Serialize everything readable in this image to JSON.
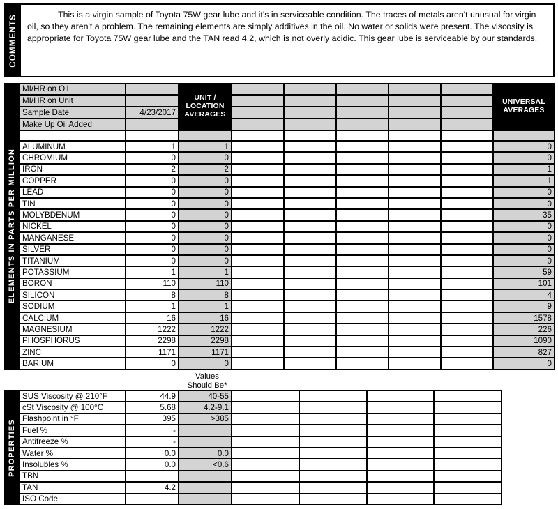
{
  "comments": {
    "label": "COMMENTS",
    "text": "This is a virgin sample of Toyota 75W gear lube and it's in serviceable condition. The traces of metals aren't unusual for virgin oil, so they aren't a problem. The remaining elements are simply additives in the oil. No water or solids were present. The viscosity is appropriate for Toyota 75W gear lube and the TAN read 4.2, which is not overly acidic. This gear lube is serviceable by our standards."
  },
  "elements_section": {
    "label": "ELEMENTS IN PARTS PER MILLION",
    "column_headers": {
      "unit_location_averages": "UNIT / LOCATION AVERAGES",
      "universal_averages": "UNIVERSAL AVERAGES"
    },
    "info_rows": [
      {
        "label": "MI/HR on Oil",
        "value": ""
      },
      {
        "label": "MI/HR on Unit",
        "value": ""
      },
      {
        "label": "Sample Date",
        "value": "4/23/2017"
      },
      {
        "label": "Make Up Oil Added",
        "value": ""
      }
    ],
    "rows": [
      {
        "name": "ALUMINUM",
        "sample": "1",
        "unit_avg": "1",
        "universal_avg": "0"
      },
      {
        "name": "CHROMIUM",
        "sample": "0",
        "unit_avg": "0",
        "universal_avg": "0"
      },
      {
        "name": "IRON",
        "sample": "2",
        "unit_avg": "2",
        "universal_avg": "1"
      },
      {
        "name": "COPPER",
        "sample": "0",
        "unit_avg": "0",
        "universal_avg": "1"
      },
      {
        "name": "LEAD",
        "sample": "0",
        "unit_avg": "0",
        "universal_avg": "0"
      },
      {
        "name": "TIN",
        "sample": "0",
        "unit_avg": "0",
        "universal_avg": "0"
      },
      {
        "name": "MOLYBDENUM",
        "sample": "0",
        "unit_avg": "0",
        "universal_avg": "35"
      },
      {
        "name": "NICKEL",
        "sample": "0",
        "unit_avg": "0",
        "universal_avg": "0"
      },
      {
        "name": "MANGANESE",
        "sample": "0",
        "unit_avg": "0",
        "universal_avg": "0"
      },
      {
        "name": "SILVER",
        "sample": "0",
        "unit_avg": "0",
        "universal_avg": "0"
      },
      {
        "name": "TITANIUM",
        "sample": "0",
        "unit_avg": "0",
        "universal_avg": "0"
      },
      {
        "name": "POTASSIUM",
        "sample": "1",
        "unit_avg": "1",
        "universal_avg": "59"
      },
      {
        "name": "BORON",
        "sample": "110",
        "unit_avg": "110",
        "universal_avg": "101"
      },
      {
        "name": "SILICON",
        "sample": "8",
        "unit_avg": "8",
        "universal_avg": "4"
      },
      {
        "name": "SODIUM",
        "sample": "1",
        "unit_avg": "1",
        "universal_avg": "9"
      },
      {
        "name": "CALCIUM",
        "sample": "16",
        "unit_avg": "16",
        "universal_avg": "1578"
      },
      {
        "name": "MAGNESIUM",
        "sample": "1222",
        "unit_avg": "1222",
        "universal_avg": "226"
      },
      {
        "name": "PHOSPHORUS",
        "sample": "2298",
        "unit_avg": "2298",
        "universal_avg": "1090"
      },
      {
        "name": "ZINC",
        "sample": "1171",
        "unit_avg": "1171",
        "universal_avg": "827"
      },
      {
        "name": "BARIUM",
        "sample": "0",
        "unit_avg": "0",
        "universal_avg": "0"
      }
    ]
  },
  "values_should_be_caption": {
    "line1": "Values",
    "line2": "Should Be*"
  },
  "properties_section": {
    "label": "PROPERTIES",
    "rows": [
      {
        "name": "SUS Viscosity @ 210°F",
        "sample": "44.9",
        "should_be": "40-55"
      },
      {
        "name": "cSt Viscosity @ 100°C",
        "sample": "5.68",
        "should_be": "4.2-9.1"
      },
      {
        "name": "Flashpoint in °F",
        "sample": "395",
        "should_be": ">385"
      },
      {
        "name": "Fuel %",
        "sample": "-",
        "should_be": ""
      },
      {
        "name": "Antifreeze %",
        "sample": "-",
        "should_be": ""
      },
      {
        "name": "Water %",
        "sample": "0.0",
        "should_be": "0.0"
      },
      {
        "name": "Insolubles %",
        "sample": "0.0",
        "should_be": "<0.6"
      },
      {
        "name": "TBN",
        "sample": "",
        "should_be": ""
      },
      {
        "name": "TAN",
        "sample": "4.2",
        "should_be": ""
      },
      {
        "name": "ISO Code",
        "sample": "",
        "should_be": ""
      }
    ]
  },
  "colors": {
    "shade": "#d3d3d3",
    "header_black": "#000000",
    "border": "#000000",
    "background": "#ffffff"
  }
}
